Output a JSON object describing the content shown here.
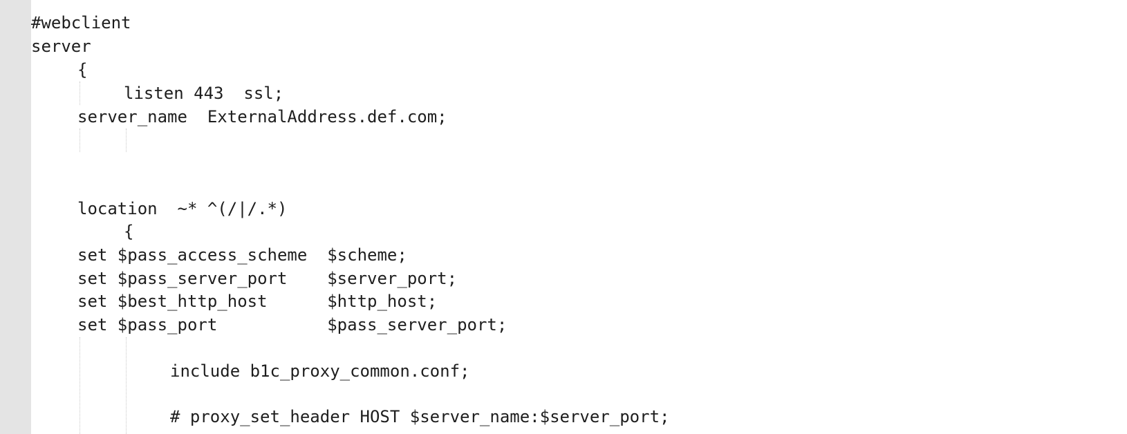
{
  "editor": {
    "lines": [
      "#webclient",
      "server",
      "{",
      "listen 443  ssl;",
      "server_name  ExternalAddress.def.com;",
      "location  ~* ^(/|/.*)",
      "{",
      "set $pass_access_scheme  $scheme;",
      "set $pass_server_port    $server_port;",
      "set $best_http_host      $http_host;",
      "set $pass_port           $pass_server_port;",
      "include b1c_proxy_common.conf;",
      "# proxy_set_header HOST $server_name:$server_port;"
    ]
  }
}
